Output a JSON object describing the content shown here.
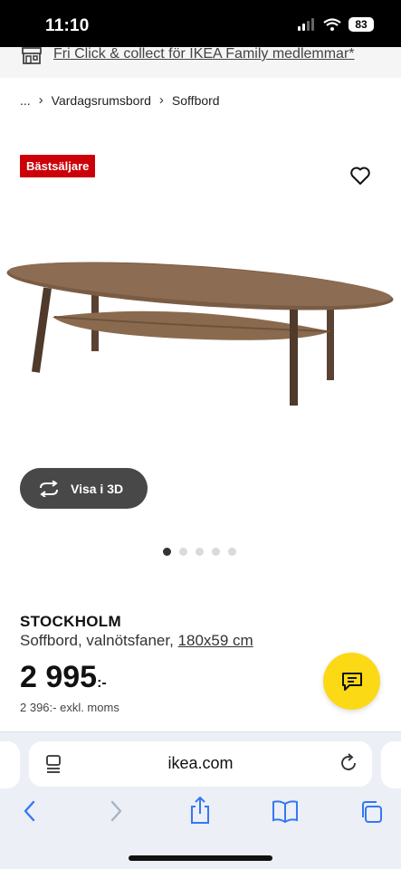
{
  "status_bar": {
    "time": "11:10",
    "battery": "83"
  },
  "promo": {
    "text": "Fri Click & collect för IKEA Family medlemmar*",
    "icon": "store-icon"
  },
  "breadcrumb": {
    "ellipsis": "...",
    "items": [
      "Vardagsrumsbord",
      "Soffbord"
    ]
  },
  "badge": "Bästsäljare",
  "gallery": {
    "view_3d_label": "Visa i 3D",
    "dot_count": 5,
    "active_index": 0
  },
  "product": {
    "name": "STOCKHOLM",
    "description": "Soffbord, valnötsfaner,",
    "size": "180x59 cm",
    "price": "2 995",
    "price_suffix": ":-",
    "price_excl": "2 396:- exkl. moms"
  },
  "browser": {
    "url": "ikea.com"
  },
  "colors": {
    "badge": "#cc0008",
    "chat_button": "#fbd914",
    "view_3d_button": "#484848",
    "browser_bar": "#eceff5",
    "safari_blue": "#3478f6"
  }
}
